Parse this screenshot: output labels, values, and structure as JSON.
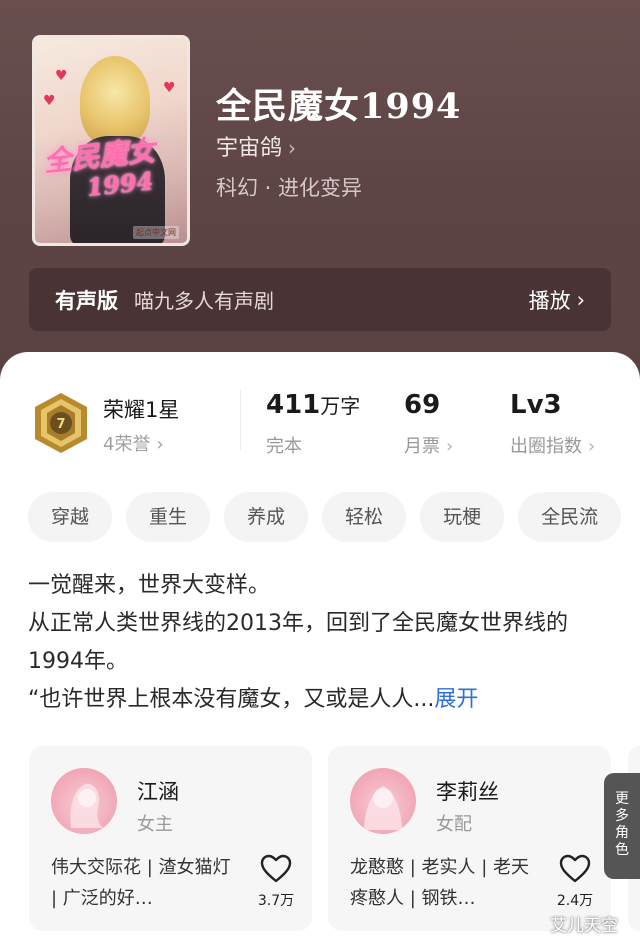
{
  "book": {
    "title": "全民魔女1994",
    "author": "宇宙鸽",
    "genre": "科幻 · 进化变异"
  },
  "cover": {
    "neon_title": "全民魔女",
    "neon_year": "1994",
    "publisher_badge": "起点中文网"
  },
  "audio": {
    "label": "有声版",
    "subtitle": "喵九多人有声剧",
    "action": "播放"
  },
  "honor": {
    "name": "荣耀1星",
    "count": "4荣誉",
    "medal_number": "7"
  },
  "stats": [
    {
      "value": "411",
      "unit": "万字",
      "label": "完本",
      "has_chevron": false
    },
    {
      "value": "69",
      "unit": "",
      "label": "月票",
      "has_chevron": true
    },
    {
      "value": "Lv3",
      "unit": "",
      "label": "出圈指数",
      "has_chevron": true
    }
  ],
  "tags": [
    "穿越",
    "重生",
    "养成",
    "轻松",
    "玩梗",
    "全民流"
  ],
  "description": {
    "line1": "一觉醒来，世界大变样。",
    "line2": "从正常人类世界线的2013年，回到了全民魔女世界线的1994年。",
    "line3": "“也许世界上根本没有魔女，又或是人人...",
    "expand": "展开"
  },
  "characters": [
    {
      "name": "江涵",
      "role": "女主",
      "tags": "伟大交际花 | 渣女猫灯 | 广泛的好…",
      "likes": "3.7万"
    },
    {
      "name": "李莉丝",
      "role": "女配",
      "tags": "龙憨憨 | 老实人 | 老天疼憨人 | 钢铁…",
      "likes": "2.4万"
    }
  ],
  "more_characters": "更多角色",
  "watermark": "艾儿天空",
  "colors": {
    "hero_bg": "#5e4545",
    "link_blue": "#2f6fd6",
    "medal_gold": "#c9a24a",
    "avatar_pink": "#f1a6b6"
  }
}
